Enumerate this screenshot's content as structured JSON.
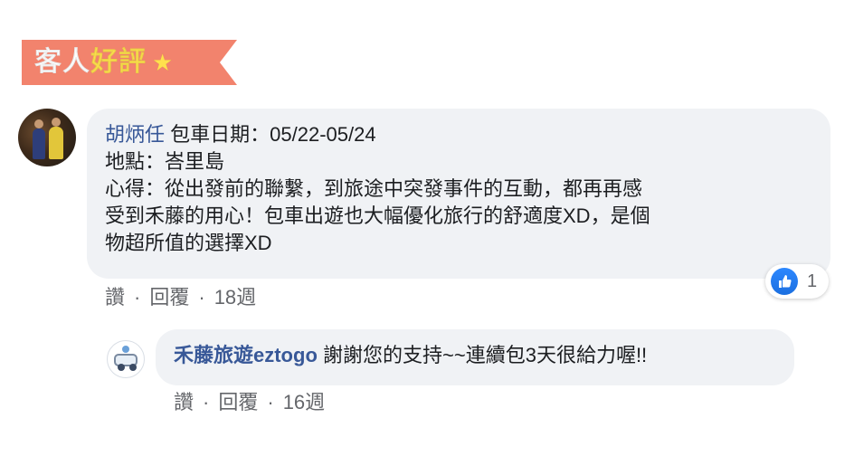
{
  "banner": {
    "title_part1": "客人",
    "title_part2": "好評",
    "star": "★"
  },
  "comment": {
    "author": "胡炳任",
    "date_line_label": "包車日期：05/22-05/24",
    "location_line": "地點：峇里島",
    "body_line1": "心得：從出發前的聯繫，到旅途中突發事件的互動，都再再感",
    "body_line2": "受到禾藤的用心！包車出遊也大幅優化旅行的舒適度XD，是個",
    "body_line3": "物超所值的選擇XD",
    "like_count": "1",
    "actions": {
      "like": "讚",
      "sep": "·",
      "reply": "回覆",
      "time": "18週"
    }
  },
  "reply": {
    "author": "禾藤旅遊eztogo",
    "text": "謝謝您的支持~~連續包3天很給力喔!!",
    "actions": {
      "like": "讚",
      "sep": "·",
      "reply": "回覆",
      "time": "16週"
    }
  },
  "icons": {
    "like": "thumbs-up-icon",
    "star": "star-icon"
  },
  "colors": {
    "banner": "#f2836d",
    "banner_highlight": "#ffe14d",
    "link": "#385898",
    "bubble": "#f0f2f5",
    "like_blue": "#2d88ff"
  }
}
